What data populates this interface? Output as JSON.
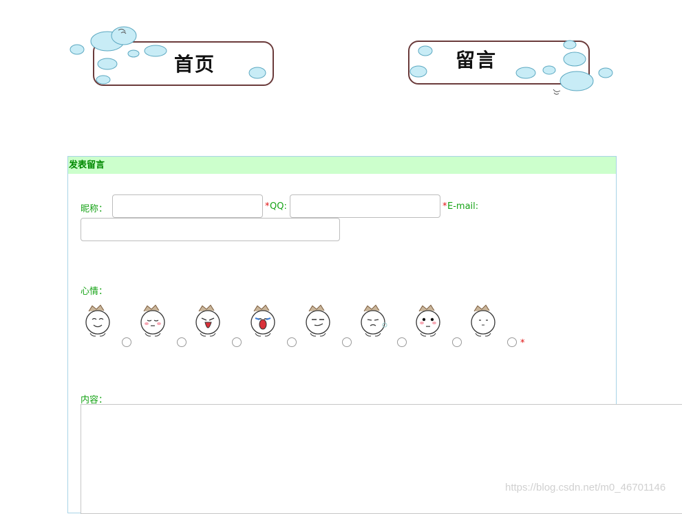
{
  "nav": {
    "home_label": "首页",
    "message_label": "留言"
  },
  "panel": {
    "title": "发表留言"
  },
  "form": {
    "nickname_label": "昵称：",
    "qq_star": "*",
    "qq_label": "QQ:",
    "email_star": "*",
    "email_label": "E-mail:",
    "mood_label": "心情：",
    "mood_star": "*",
    "content_label": "内容："
  },
  "moods": [
    {
      "icon": "happy-face-icon"
    },
    {
      "icon": "shy-face-icon"
    },
    {
      "icon": "shout-face-icon"
    },
    {
      "icon": "crying-face-icon"
    },
    {
      "icon": "smirk-face-icon"
    },
    {
      "icon": "sigh-face-icon"
    },
    {
      "icon": "thinking-face-icon"
    },
    {
      "icon": "calm-face-icon"
    }
  ],
  "watermark": "https://blog.csdn.net/m0_46701146",
  "colors": {
    "label_green": "#16a316",
    "header_bg": "#ccffcc",
    "header_text": "#008800",
    "panel_border": "#a8d4e6",
    "required_red": "#e01010",
    "cloud_blue": "#c8ecf6"
  }
}
